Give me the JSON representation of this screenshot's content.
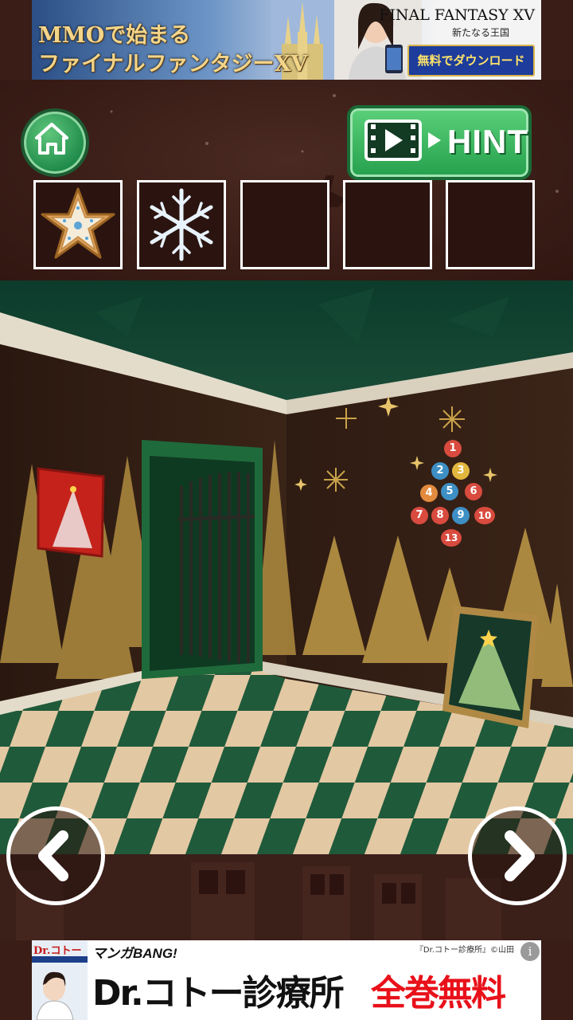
{
  "ad_top": {
    "line1": "MMOで始まる",
    "line2": "ファイナルファンタジーXV",
    "brand": "FINAL FANTASY XV",
    "brand_sub": "新たなる王国",
    "download_label": "無料でダウンロード"
  },
  "toolbar": {
    "home_icon": "home-icon",
    "hint_label": "HINT",
    "hint_icon": "video-play-icon"
  },
  "inventory": {
    "slots": [
      {
        "item": "star-cookie-icon"
      },
      {
        "item": "snowflake-icon"
      },
      {
        "item": ""
      },
      {
        "item": ""
      },
      {
        "item": ""
      }
    ]
  },
  "scene": {
    "ornament_numbers": [
      "1",
      "2",
      "3",
      "5",
      "4",
      "6",
      "7",
      "8",
      "9",
      "10",
      "13"
    ],
    "colors": {
      "floor_green": "#1f5a3a",
      "floor_tan": "#e3c8a4",
      "wall": "#2e1a12",
      "gold": "#c9a24a",
      "door_green": "#1f6a3b"
    }
  },
  "navigation": {
    "left_icon": "chevron-left-icon",
    "right_icon": "chevron-right-icon"
  },
  "ad_bottom": {
    "book_title": "Dr.コトー",
    "manga_label": "マンガBANG!",
    "credit": "『Dr.コトー診療所』©山田",
    "headline_a": "Dr.コトー診療所",
    "headline_b": "全巻無料",
    "info_icon": "info-icon",
    "info_glyph": "i"
  }
}
